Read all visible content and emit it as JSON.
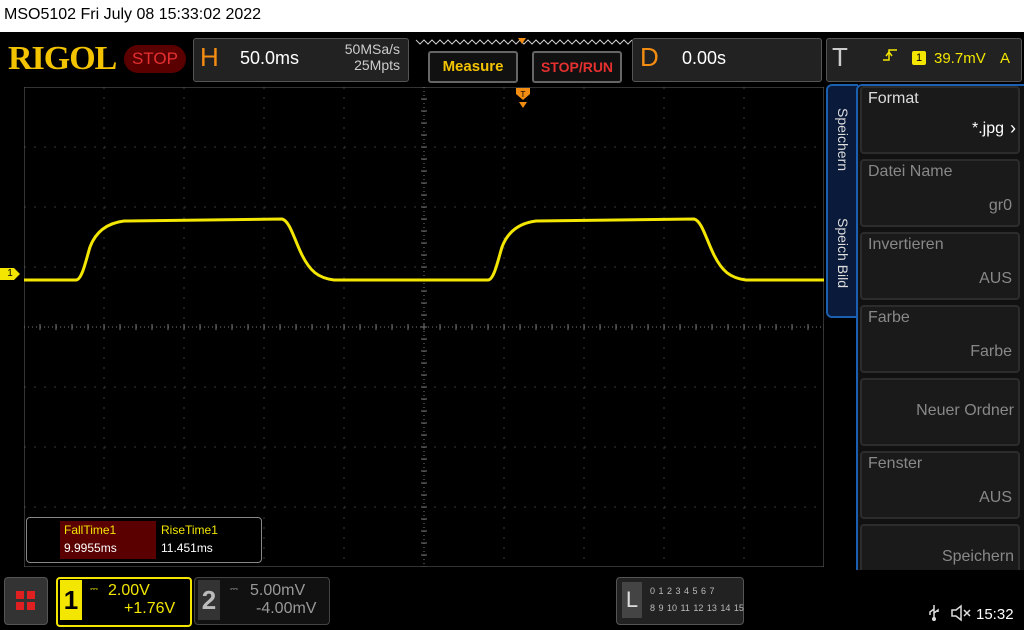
{
  "header": {
    "device_datetime": "MSO5102  Fri July 08 15:33:02 2022"
  },
  "brand": {
    "logo_text": "RIGOL",
    "run_state": "STOP"
  },
  "horizontal": {
    "letter": "H",
    "timebase": "50.0ms",
    "sample_rate": "50MSa/s",
    "memory_depth": "25Mpts"
  },
  "buttons": {
    "measure": "Measure",
    "stop_run": "STOP/RUN"
  },
  "delay": {
    "letter": "D",
    "value": "0.00s"
  },
  "trigger": {
    "letter": "T",
    "slope_icon": "rising-edge-icon",
    "source": "1",
    "level": "39.7mV",
    "coupling": "A"
  },
  "waveform": {
    "channel_marker": "1",
    "color": "#f3e600"
  },
  "measurements": {
    "items": [
      {
        "label": "FallTime1",
        "value": "9.9955ms"
      },
      {
        "label": "RiseTime1",
        "value": "11.451ms"
      }
    ]
  },
  "side_tabs": [
    "Speichern",
    "Speich Bild"
  ],
  "menu": {
    "items": [
      {
        "label": "Format",
        "value": "*.jpg"
      },
      {
        "label": "Datei Name",
        "value": "gr0"
      },
      {
        "label": "Invertieren",
        "value": "AUS"
      },
      {
        "label": "Farbe",
        "value": "Farbe"
      },
      {
        "label": "",
        "value": "Neuer Ordner"
      },
      {
        "label": "Fenster",
        "value": "AUS"
      },
      {
        "label": "",
        "value": "Speichern"
      }
    ]
  },
  "channels": {
    "ch1": {
      "number": "1",
      "scale": "2.00V",
      "offset": "+1.76V"
    },
    "ch2": {
      "number": "2",
      "scale": "5.00mV",
      "offset": "-4.00mV"
    }
  },
  "logic_analyzer": {
    "letter": "L",
    "row1": "0 1 2 3  4 5 6 7",
    "row2": "8 9 10 11 12 13 14 15"
  },
  "status": {
    "usb_icon": "usb-icon",
    "speaker_icon": "speaker-muted-icon",
    "clock": "15:32"
  },
  "colors": {
    "accent_orange": "#f38d12",
    "trace_yellow": "#f3e600",
    "menu_blue": "#1b5fb0"
  }
}
